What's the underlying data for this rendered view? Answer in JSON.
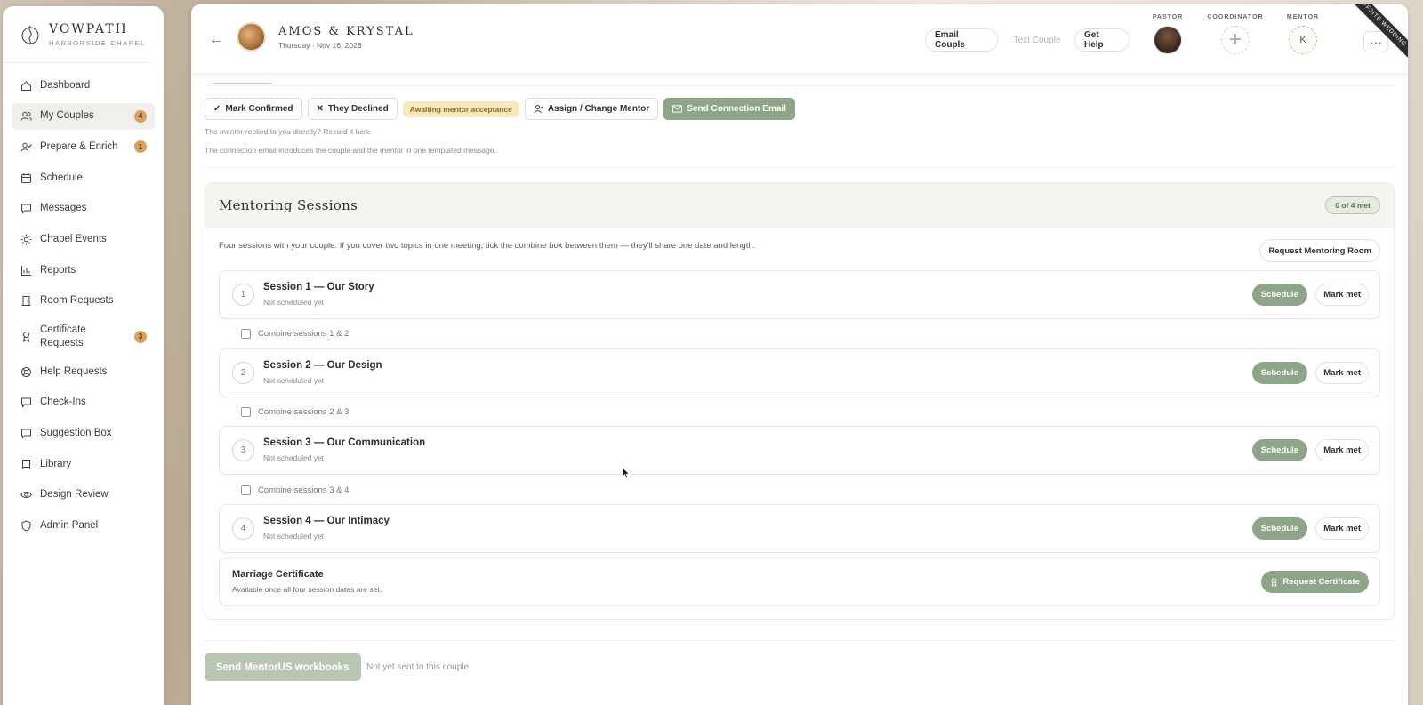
{
  "brand": {
    "name": "VOWPATH",
    "sub": "HARBORSIDE CHAPEL"
  },
  "nav": [
    {
      "label": "Dashboard",
      "icon": "home-icon",
      "active": false,
      "badge": null
    },
    {
      "label": "My Couples",
      "icon": "users-icon",
      "active": true,
      "badge": "4"
    },
    {
      "label": "Prepare & Enrich",
      "icon": "user-check-icon",
      "active": false,
      "badge": "1"
    },
    {
      "label": "Schedule",
      "icon": "calendar-icon",
      "active": false,
      "badge": null
    },
    {
      "label": "Messages",
      "icon": "message-icon",
      "active": false,
      "badge": null
    },
    {
      "label": "Chapel Events",
      "icon": "sun-icon",
      "active": false,
      "badge": null
    },
    {
      "label": "Reports",
      "icon": "bar-chart-icon",
      "active": false,
      "badge": null
    },
    {
      "label": "Room Requests",
      "icon": "door-icon",
      "active": false,
      "badge": null
    },
    {
      "label": "Certificate Requests",
      "icon": "award-icon",
      "active": false,
      "badge": "3"
    },
    {
      "label": "Help Requests",
      "icon": "lifebuoy-icon",
      "active": false,
      "badge": null
    },
    {
      "label": "Check-Ins",
      "icon": "message-square-icon",
      "active": false,
      "badge": null
    },
    {
      "label": "Suggestion Box",
      "icon": "message-square-icon",
      "active": false,
      "badge": null
    },
    {
      "label": "Library",
      "icon": "book-icon",
      "active": false,
      "badge": null
    },
    {
      "label": "Design Review",
      "icon": "eye-icon",
      "active": false,
      "badge": null
    },
    {
      "label": "Admin Panel",
      "icon": "shield-icon",
      "active": false,
      "badge": null
    }
  ],
  "header": {
    "couple_name": "AMOS & KRYSTAL",
    "date": "Thursday · Nov 16, 2028",
    "email_btn": "Email Couple",
    "text_btn": "Text Couple",
    "help_btn": "Get Help",
    "pastor_label": "PASTOR",
    "coordinator_label": "COORDINATOR",
    "mentor_label": "MENTOR",
    "mentor_initial": "K",
    "more": "···",
    "ribbon": "OFFSITE WEDDING"
  },
  "actions": {
    "confirm": "Mark Confirmed",
    "decline": "They Declined",
    "status": "Awaiting mentor acceptance",
    "assign": "Assign / Change Mentor",
    "send": "Send Connection Email",
    "hint1": "The mentor replied to you directly? Record it here.",
    "hint2": "The connection email introduces the couple and the mentor in one templated message."
  },
  "sessions": {
    "title": "Mentoring Sessions",
    "count": "0 of 4 met",
    "description": "Four sessions with your couple. If you cover two topics in one meeting, tick the combine box between them — they'll share one date and length.",
    "room_btn": "Request Mentoring Room",
    "schedule_label": "Schedule",
    "met_label": "Mark met",
    "items": [
      {
        "num": "1",
        "name": "Session 1 — Our Story",
        "status": "Not scheduled yet"
      },
      {
        "num": "2",
        "name": "Session 2 — Our Design",
        "status": "Not scheduled yet"
      },
      {
        "num": "3",
        "name": "Session 3 — Our Communication",
        "status": "Not scheduled yet"
      },
      {
        "num": "4",
        "name": "Session 4 — Our Intimacy",
        "status": "Not scheduled yet"
      }
    ],
    "combine": [
      "Combine sessions 1 & 2",
      "Combine sessions 2 & 3",
      "Combine sessions 3 & 4"
    ]
  },
  "certificate": {
    "title": "Marriage Certificate",
    "desc": "Available once all four session dates are set.",
    "btn": "Request Certificate"
  },
  "workbooks": {
    "btn": "Send MentorUS workbooks",
    "note": "Not yet sent to this couple"
  }
}
